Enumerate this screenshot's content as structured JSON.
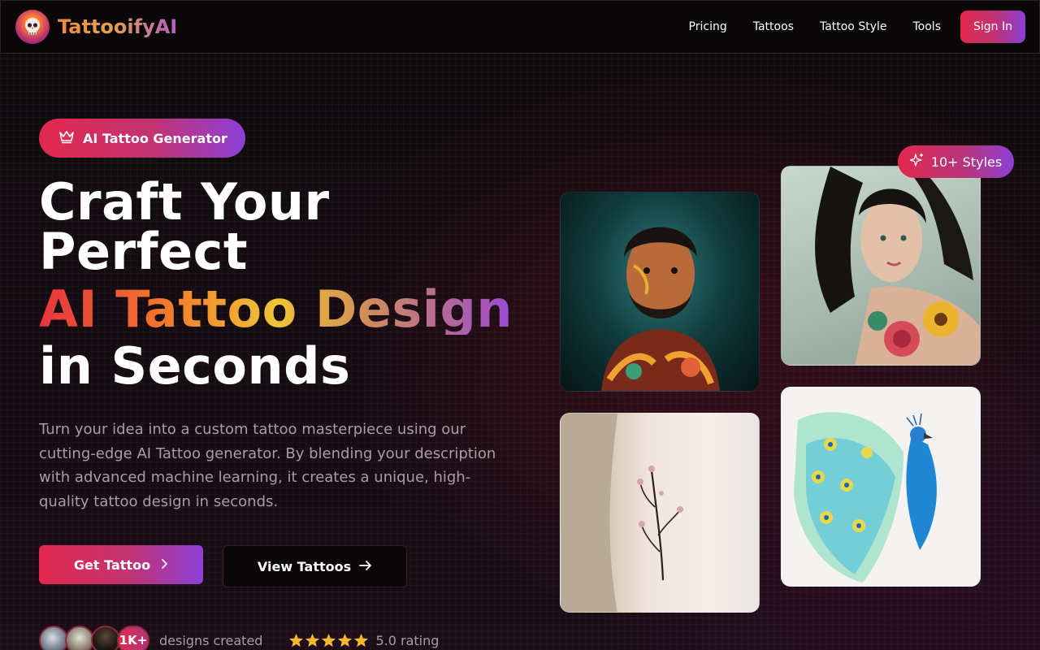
{
  "nav": {
    "brand": "TattooifyAI",
    "links": [
      "Pricing",
      "Tattoos",
      "Tattoo Style",
      "Tools"
    ],
    "sign_in": "Sign In"
  },
  "hero": {
    "badge": "AI Tattoo Generator",
    "headline_line1": "Craft Your",
    "headline_line2": "Perfect",
    "headline_highlight": "AI Tattoo Design",
    "headline_line4": "in Seconds",
    "description": "Turn your idea into a custom tattoo masterpiece using our cutting-edge AI Tattoo generator. By blending your description with advanced machine learning, it creates a unique, high-quality tattoo design in seconds.",
    "primary_cta": "Get Tattoo",
    "secondary_cta": "View Tattoos",
    "designs_count": "1K+",
    "designs_label": "designs created",
    "rating_label": "5.0 rating",
    "stars": 5
  },
  "gallery": {
    "styles_badge": "10+ Styles",
    "images": [
      "tattooed-man-portrait",
      "woman-floral-shoulder-tattoo",
      "cherry-blossom-arm-tattoo",
      "watercolor-peacock-design"
    ]
  },
  "colors": {
    "accent_start": "#e3284d",
    "accent_end": "#8d3fd8",
    "background": "#0d0a0c",
    "muted_text": "#a79ea3",
    "star": "#f5b82e"
  }
}
